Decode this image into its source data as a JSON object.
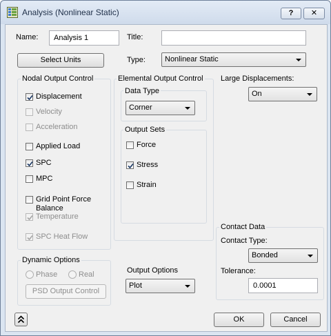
{
  "window": {
    "title": "Analysis (Nonlinear Static)",
    "help_label": "?",
    "close_label": "✕"
  },
  "name": {
    "label": "Name:",
    "value": "Analysis 1"
  },
  "title": {
    "label": "Title:",
    "value": ""
  },
  "select_units_label": "Select Units",
  "type": {
    "label": "Type:",
    "value": "Nonlinear Static"
  },
  "nodal": {
    "group_label": "Nodal Output Control",
    "items": [
      {
        "label": "Displacement",
        "checked": true,
        "enabled": true
      },
      {
        "label": "Velocity",
        "checked": false,
        "enabled": false
      },
      {
        "label": "Acceleration",
        "checked": false,
        "enabled": false
      },
      {
        "label": "Applied Load",
        "checked": false,
        "enabled": true
      },
      {
        "label": "SPC",
        "checked": true,
        "enabled": true
      },
      {
        "label": "MPC",
        "checked": false,
        "enabled": true
      },
      {
        "label": "Grid Point Force",
        "label2": "Balance",
        "checked": false,
        "enabled": true
      },
      {
        "label": "Temperature",
        "checked": true,
        "enabled": false
      },
      {
        "label": "SPC Heat Flow",
        "checked": true,
        "enabled": false
      }
    ]
  },
  "elemental": {
    "group_label": "Elemental Output Control",
    "data_type_label": "Data Type",
    "data_type_value": "Corner",
    "output_sets_label": "Output Sets",
    "sets": [
      {
        "label": "Force",
        "checked": false
      },
      {
        "label": "Stress",
        "checked": true
      },
      {
        "label": "Strain",
        "checked": false
      }
    ]
  },
  "large_disp": {
    "label": "Large Displacements:",
    "value": "On"
  },
  "dynamic": {
    "group_label": "Dynamic Options",
    "phase_label": "Phase",
    "real_label": "Real",
    "psd_label": "PSD Output Control"
  },
  "output_options": {
    "label": "Output Options",
    "value": "Plot"
  },
  "contact": {
    "group_label": "Contact Data",
    "type_label": "Contact Type:",
    "type_value": "Bonded",
    "tolerance_label": "Tolerance:",
    "tolerance_value": "0.0001"
  },
  "buttons": {
    "ok": "OK",
    "cancel": "Cancel"
  },
  "icons": {
    "app": "analysis-grid-icon",
    "expand": "double-chevron-up-icon"
  }
}
